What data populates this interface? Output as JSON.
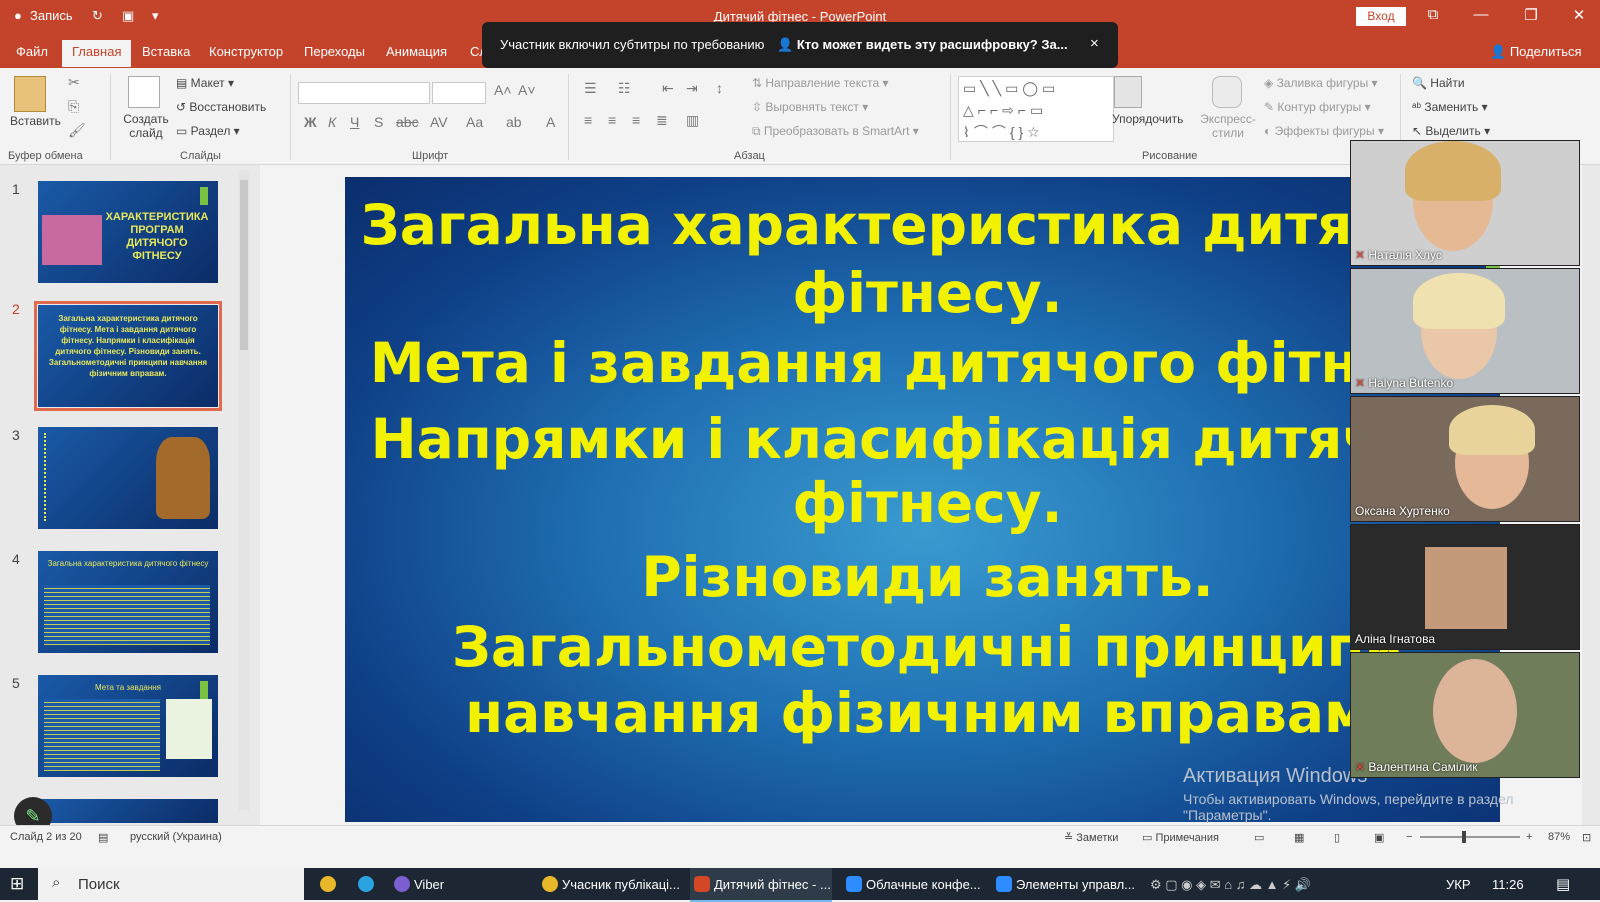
{
  "titlebar": {
    "title": "Дитячий фітнес - PowerPoint",
    "quick_access_label": "Запись",
    "signin_label": "Вход"
  },
  "tabs": [
    {
      "label": "Файл"
    },
    {
      "label": "Главная"
    },
    {
      "label": "Вставка"
    },
    {
      "label": "Конструктор"
    },
    {
      "label": "Переходы"
    },
    {
      "label": "Анимация"
    },
    {
      "label": "Слайд-шоу"
    }
  ],
  "share_label": "Поделиться",
  "notification": {
    "message": "Участник включил субтитры по требованию",
    "link": "Кто может видеть эту расшифровку? За...",
    "close": "×"
  },
  "ribbon": {
    "clipboard": {
      "paste": "Вставить",
      "group": "Буфер обмена"
    },
    "slides": {
      "new_slide": "Создать слайд",
      "layout": "Макет",
      "reset": "Восстановить",
      "section": "Раздел",
      "group": "Слайды"
    },
    "font": {
      "group": "Шрифт"
    },
    "paragraph": {
      "text_direction": "Направление текста",
      "align_text": "Выровнять текст",
      "smartart": "Преобразовать в SmartArt",
      "group": "Абзац"
    },
    "drawing": {
      "arrange": "Упорядочить",
      "quick_styles": "Экспресс-стили",
      "fill": "Заливка фигуры",
      "outline": "Контур фигуры",
      "effects": "Эффекты фигуры",
      "group": "Рисование"
    },
    "editing": {
      "find": "Найти",
      "replace": "Заменить",
      "select": "Выделить"
    }
  },
  "thumbnails": [
    {
      "num": "1",
      "title": "ХАРАКТЕРИСТИКА ПРОГРАМ ДИТЯЧОГО ФІТНЕСУ"
    },
    {
      "num": "2",
      "title": "Загальна характеристика дитячого фітнесу. Мета і завдання дитячого фітнесу. Напрямки і класифікація дитячого фітнесу. Різновиди занять. Загальнометодичні принципи навчання фізичним вправам."
    },
    {
      "num": "3",
      "title": ""
    },
    {
      "num": "4",
      "title": "Загальна характеристика дитячого фітнесу"
    },
    {
      "num": "5",
      "title": "Мета та завдання"
    }
  ],
  "slide": {
    "lines": [
      "Загальна характеристика дитячого",
      "фітнесу.",
      "Мета і завдання дитячого фітнесу.",
      "Напрямки і класифікація дитячого",
      "фітнесу.",
      "Різновиди занять.",
      "Загальнометодичні принципи",
      "навчання фізичним вправам."
    ]
  },
  "watermark": {
    "line1": "Активация Windows",
    "line2": "Чтобы активировать Windows, перейдите в раздел",
    "line3": "\"Параметры\"."
  },
  "participants": [
    {
      "name": "Наталія Хлус"
    },
    {
      "name": "Halyna Butenko"
    },
    {
      "name": "Оксана Хуртенко"
    },
    {
      "name": "Аліна Ігнатова"
    },
    {
      "name": "Валентина Самілик"
    }
  ],
  "status": {
    "slide_counter": "Слайд 2 из 20",
    "language": "русский (Украина)",
    "notes": "Заметки",
    "comments": "Примечания",
    "zoom": "87%"
  },
  "taskbar": {
    "search": "Поиск",
    "apps": [
      "Viber",
      "Учасник публікаці...",
      "Дитячий фітнес - ...",
      "Облачные конфе...",
      "Элементы управл..."
    ],
    "lang": "УКР",
    "time": "11:26"
  },
  "colors": {
    "accent": "#c4432b",
    "slide_text": "#f2f200",
    "slide_bg": "#1f6fb3",
    "bar_green": "#7cc242"
  }
}
